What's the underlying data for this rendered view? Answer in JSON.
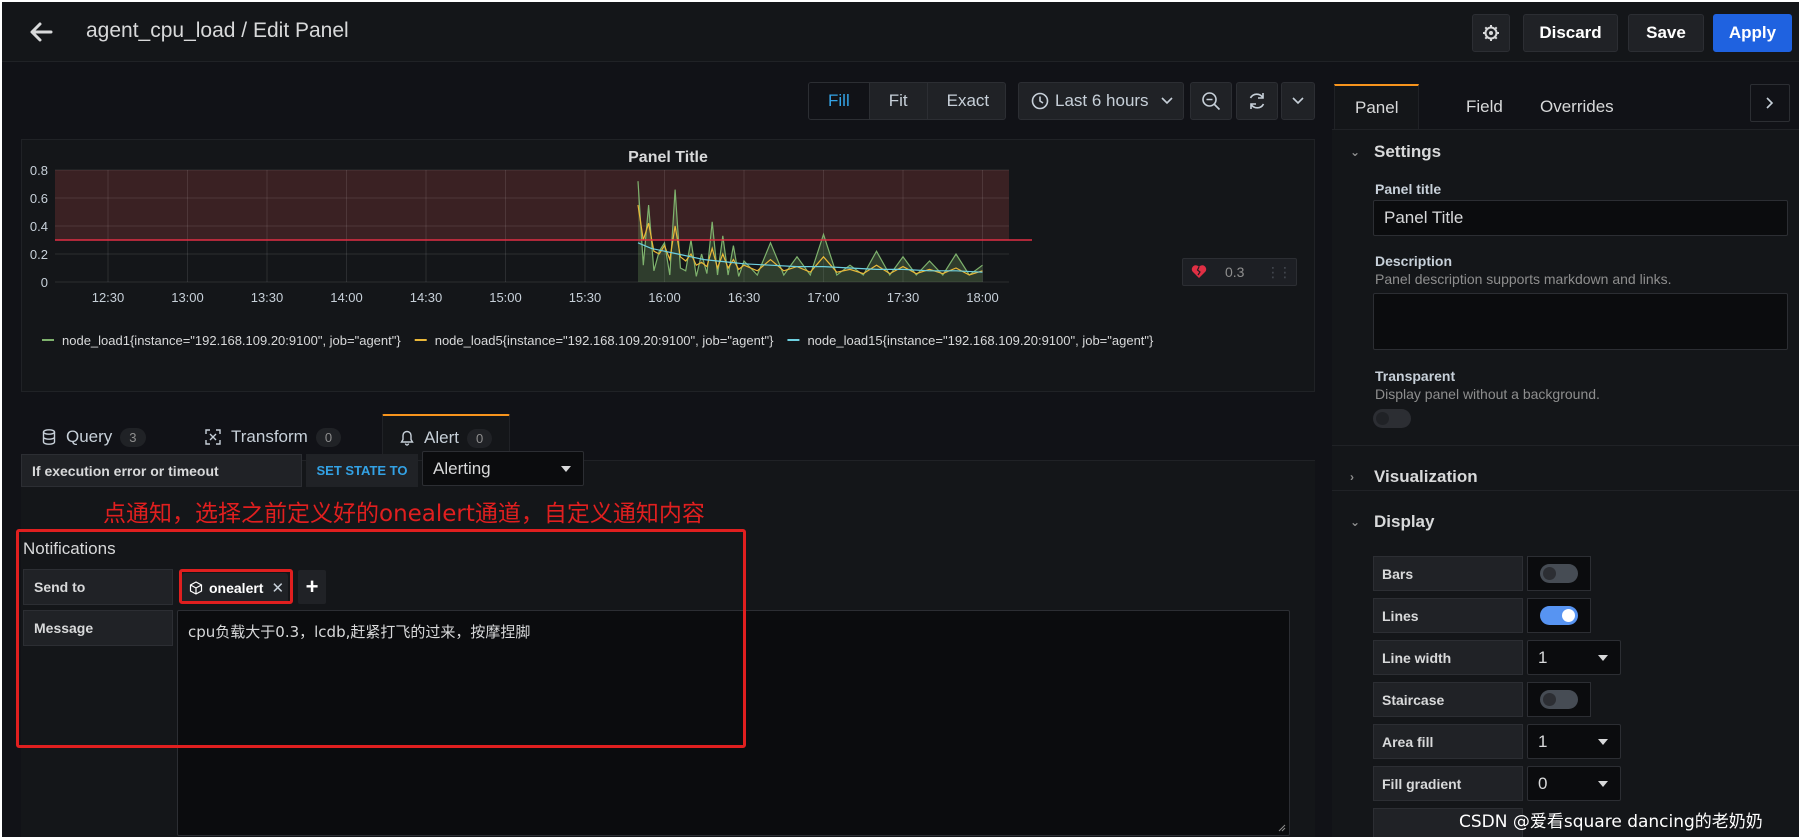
{
  "header": {
    "title": "agent_cpu_load / Edit Panel",
    "discard_label": "Discard",
    "save_label": "Save",
    "apply_label": "Apply"
  },
  "toolbar": {
    "view_modes": [
      "Fill",
      "Fit",
      "Exact"
    ],
    "active_view_mode": "Fill",
    "time_range": "Last 6 hours"
  },
  "panel": {
    "title": "Panel Title",
    "threshold_value": "0.3"
  },
  "chart_data": {
    "type": "line",
    "title": "Panel Title",
    "y_ticks": [
      "0.8",
      "0.6",
      "0.4",
      "0.2",
      "0"
    ],
    "ylim": [
      0,
      0.8
    ],
    "x_ticks": [
      "12:30",
      "13:00",
      "13:30",
      "14:00",
      "14:30",
      "15:00",
      "15:30",
      "16:00",
      "16:30",
      "17:00",
      "17:30",
      "18:00"
    ],
    "threshold": 0.3,
    "grid": true,
    "legend": "bottom",
    "series": [
      {
        "name": "node_load1{instance=\"192.168.109.20:9100\", job=\"agent\"}",
        "color": "#7eb26d",
        "x": [
          "15:50",
          "15:52",
          "15:54",
          "15:56",
          "15:58",
          "16:00",
          "16:02",
          "16:04",
          "16:06",
          "16:08",
          "16:10",
          "16:12",
          "16:14",
          "16:16",
          "16:18",
          "16:20",
          "16:22",
          "16:24",
          "16:26",
          "16:28",
          "16:30",
          "16:35",
          "16:40",
          "16:45",
          "16:50",
          "16:55",
          "17:00",
          "17:05",
          "17:10",
          "17:15",
          "17:20",
          "17:25",
          "17:30",
          "17:35",
          "17:40",
          "17:45",
          "17:50",
          "17:55",
          "18:00"
        ],
        "values": [
          0.72,
          0.12,
          0.55,
          0.08,
          0.22,
          0.28,
          0.05,
          0.66,
          0.1,
          0.08,
          0.3,
          0.04,
          0.2,
          0.06,
          0.43,
          0.05,
          0.33,
          0.05,
          0.26,
          0.04,
          0.15,
          0.05,
          0.28,
          0.05,
          0.18,
          0.05,
          0.34,
          0.05,
          0.12,
          0.05,
          0.22,
          0.05,
          0.18,
          0.05,
          0.15,
          0.05,
          0.2,
          0.05,
          0.12
        ]
      },
      {
        "name": "node_load5{instance=\"192.168.109.20:9100\", job=\"agent\"}",
        "color": "#eab839",
        "x": [
          "15:50",
          "15:52",
          "15:54",
          "15:56",
          "15:58",
          "16:00",
          "16:02",
          "16:04",
          "16:06",
          "16:08",
          "16:10",
          "16:12",
          "16:14",
          "16:16",
          "16:18",
          "16:20",
          "16:22",
          "16:24",
          "16:26",
          "16:28",
          "16:30",
          "16:35",
          "16:40",
          "16:45",
          "16:50",
          "16:55",
          "17:00",
          "17:05",
          "17:10",
          "17:15",
          "17:20",
          "17:25",
          "17:30",
          "17:35",
          "17:40",
          "17:45",
          "17:50",
          "17:55",
          "18:00"
        ],
        "values": [
          0.55,
          0.3,
          0.42,
          0.22,
          0.2,
          0.26,
          0.16,
          0.4,
          0.18,
          0.15,
          0.2,
          0.12,
          0.14,
          0.11,
          0.24,
          0.1,
          0.2,
          0.1,
          0.16,
          0.09,
          0.12,
          0.08,
          0.16,
          0.08,
          0.11,
          0.07,
          0.18,
          0.07,
          0.09,
          0.06,
          0.12,
          0.06,
          0.11,
          0.06,
          0.09,
          0.06,
          0.1,
          0.05,
          0.08
        ]
      },
      {
        "name": "node_load15{instance=\"192.168.109.20:9100\", job=\"agent\"}",
        "color": "#6ed0e0",
        "x": [
          "15:50",
          "15:55",
          "16:00",
          "16:05",
          "16:10",
          "16:15",
          "16:20",
          "16:25",
          "16:30",
          "16:40",
          "16:50",
          "17:00",
          "17:10",
          "17:20",
          "17:30",
          "17:40",
          "17:50",
          "18:00"
        ],
        "values": [
          0.28,
          0.24,
          0.22,
          0.2,
          0.18,
          0.16,
          0.15,
          0.14,
          0.13,
          0.12,
          0.11,
          0.11,
          0.1,
          0.09,
          0.09,
          0.08,
          0.08,
          0.07
        ]
      }
    ]
  },
  "editor": {
    "tabs": [
      {
        "label": "Query",
        "count": "3"
      },
      {
        "label": "Transform",
        "count": "0"
      },
      {
        "label": "Alert",
        "count": "0"
      }
    ],
    "error_label": "If execution error or timeout",
    "set_state_label": "SET STATE TO",
    "state_value": "Alerting",
    "annotation": "点通知，选择之前定义好的onealert通道，自定义通知内容",
    "notifications_title": "Notifications",
    "send_to_label": "Send to",
    "channel": "onealert",
    "message_label": "Message",
    "message_value": "cpu负载大于0.3，lcdb,赶紧打飞的过来，按摩捏脚"
  },
  "options": {
    "tabs": [
      "Panel",
      "Field",
      "Overrides"
    ],
    "settings_title": "Settings",
    "panel_title_label": "Panel title",
    "panel_title_value": "Panel Title",
    "description_label": "Description",
    "description_help": "Panel description supports markdown and links.",
    "transparent_label": "Transparent",
    "transparent_help": "Display panel without a background.",
    "visualization_title": "Visualization",
    "display_title": "Display",
    "display_rows": [
      {
        "label": "Bars",
        "kind": "toggle",
        "on": false
      },
      {
        "label": "Lines",
        "kind": "toggle",
        "on": true
      },
      {
        "label": "Line width",
        "kind": "select",
        "value": "1"
      },
      {
        "label": "Staircase",
        "kind": "toggle",
        "on": false
      },
      {
        "label": "Area fill",
        "kind": "select",
        "value": "1"
      },
      {
        "label": "Fill gradient",
        "kind": "select",
        "value": "0"
      }
    ]
  },
  "watermark": "CSDN @爱看square dancing的老奶奶"
}
